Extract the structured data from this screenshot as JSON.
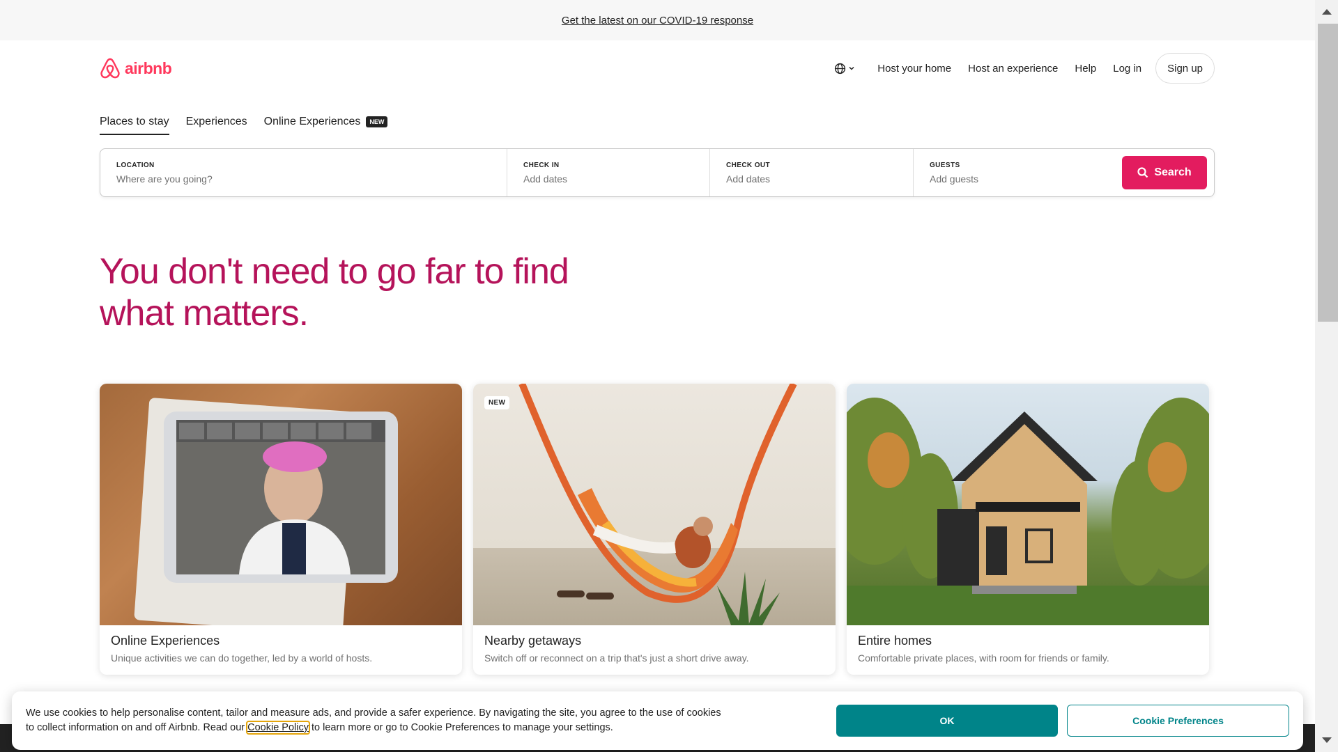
{
  "banner": {
    "link_text": "Get the latest on our COVID-19 response"
  },
  "header": {
    "logo_text": "airbnb",
    "brand_color": "#ff385c",
    "nav": {
      "host_home": "Host your home",
      "host_experience": "Host an experience",
      "help": "Help",
      "login": "Log in",
      "signup": "Sign up"
    }
  },
  "tabs": [
    {
      "label": "Places to stay",
      "active": true
    },
    {
      "label": "Experiences",
      "active": false
    },
    {
      "label": "Online Experiences",
      "badge": "NEW",
      "active": false
    }
  ],
  "search": {
    "location": {
      "label": "LOCATION",
      "placeholder": "Where are you going?"
    },
    "check_in": {
      "label": "CHECK IN",
      "value": "Add dates"
    },
    "check_out": {
      "label": "CHECK OUT",
      "value": "Add dates"
    },
    "guests": {
      "label": "GUESTS",
      "value": "Add guests"
    },
    "button_label": "Search",
    "button_color": "#e31c5f"
  },
  "hero": {
    "headline_line1": "You don't need to go far to find",
    "headline_line2": "what matters."
  },
  "cards": [
    {
      "title": "Online Experiences",
      "subtitle": "Unique activities we can do together, led by a world of hosts.",
      "icon": "tablet-video-call-image"
    },
    {
      "title": "Nearby getaways",
      "subtitle": "Switch off or reconnect on a trip that's just a short drive away.",
      "badge": "NEW",
      "icon": "hammock-image"
    },
    {
      "title": "Entire homes",
      "subtitle": "Comfortable private places, with room for friends or family.",
      "icon": "cabin-house-image"
    }
  ],
  "cookie": {
    "text_before": "We use cookies to help personalise content, tailor and measure ads, and provide a safer experience. By navigating the site, you agree to the use of cookies to collect information on and off Airbnb. Read our ",
    "link_text": "Cookie Policy",
    "text_after": " to learn more or go to Cookie Preferences to manage your settings.",
    "ok_label": "OK",
    "preferences_label": "Cookie Preferences",
    "accent_color": "#008489"
  }
}
